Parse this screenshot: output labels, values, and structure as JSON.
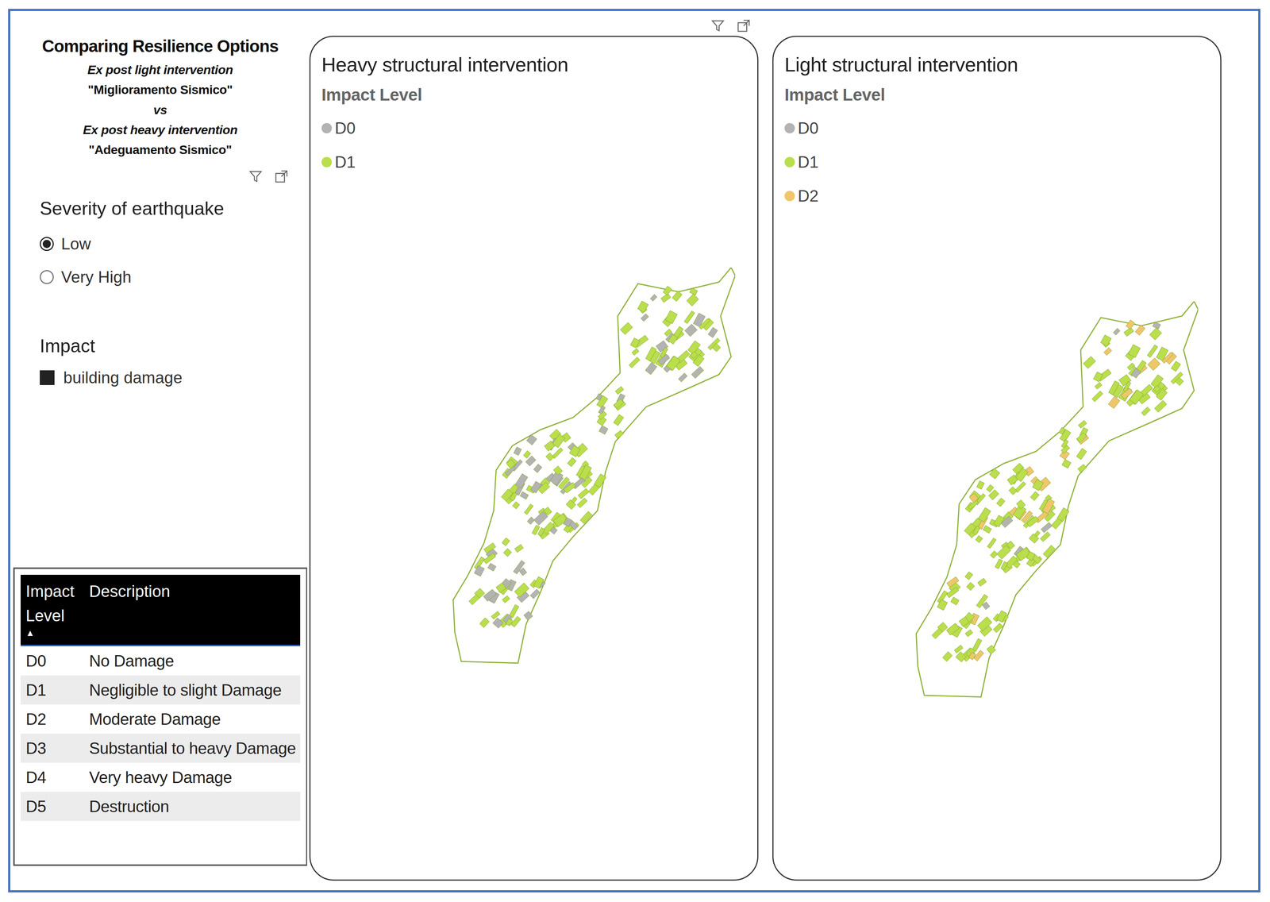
{
  "left_panel": {
    "title": "Comparing Resilience Options",
    "subtitle_lines": [
      {
        "text": "Ex post light intervention",
        "kind": "italic"
      },
      {
        "text": "\"Miglioramento Sismico\"",
        "kind": "plain"
      },
      {
        "text": "vs",
        "kind": "italic"
      },
      {
        "text": "Ex post heavy intervention",
        "kind": "italic"
      },
      {
        "text": "\"Adeguamento Sismico\"",
        "kind": "plain"
      }
    ]
  },
  "severity": {
    "title": "Severity of earthquake",
    "options": [
      {
        "label": "Low",
        "selected": true
      },
      {
        "label": "Very High",
        "selected": false
      }
    ]
  },
  "impact": {
    "title": "Impact",
    "legend": [
      {
        "label": "building damage",
        "color": "#222222"
      }
    ]
  },
  "table": {
    "columns": [
      {
        "label": "Impact Level",
        "sort": "▲"
      },
      {
        "label": "Description",
        "sort": ""
      }
    ],
    "rows": [
      [
        "D0",
        "No Damage"
      ],
      [
        "D1",
        "Negligible to slight Damage"
      ],
      [
        "D2",
        "Moderate Damage"
      ],
      [
        "D3",
        "Substantial to heavy Damage"
      ],
      [
        "D4",
        "Very heavy Damage"
      ],
      [
        "D5",
        "Destruction"
      ]
    ]
  },
  "maps": [
    {
      "title": "Heavy structural intervention",
      "legend_title": "Impact Level",
      "levels": [
        {
          "label": "D0",
          "color": "#b3b3b3",
          "share": 0.35
        },
        {
          "label": "D1",
          "color": "#bade4c",
          "share": 0.65
        }
      ]
    },
    {
      "title": "Light structural intervention",
      "legend_title": "Impact Level",
      "levels": [
        {
          "label": "D0",
          "color": "#b3b3b3",
          "share": 0.06
        },
        {
          "label": "D1",
          "color": "#bade4c",
          "share": 0.72
        },
        {
          "label": "D2",
          "color": "#f0c66a",
          "share": 0.22
        }
      ]
    }
  ]
}
